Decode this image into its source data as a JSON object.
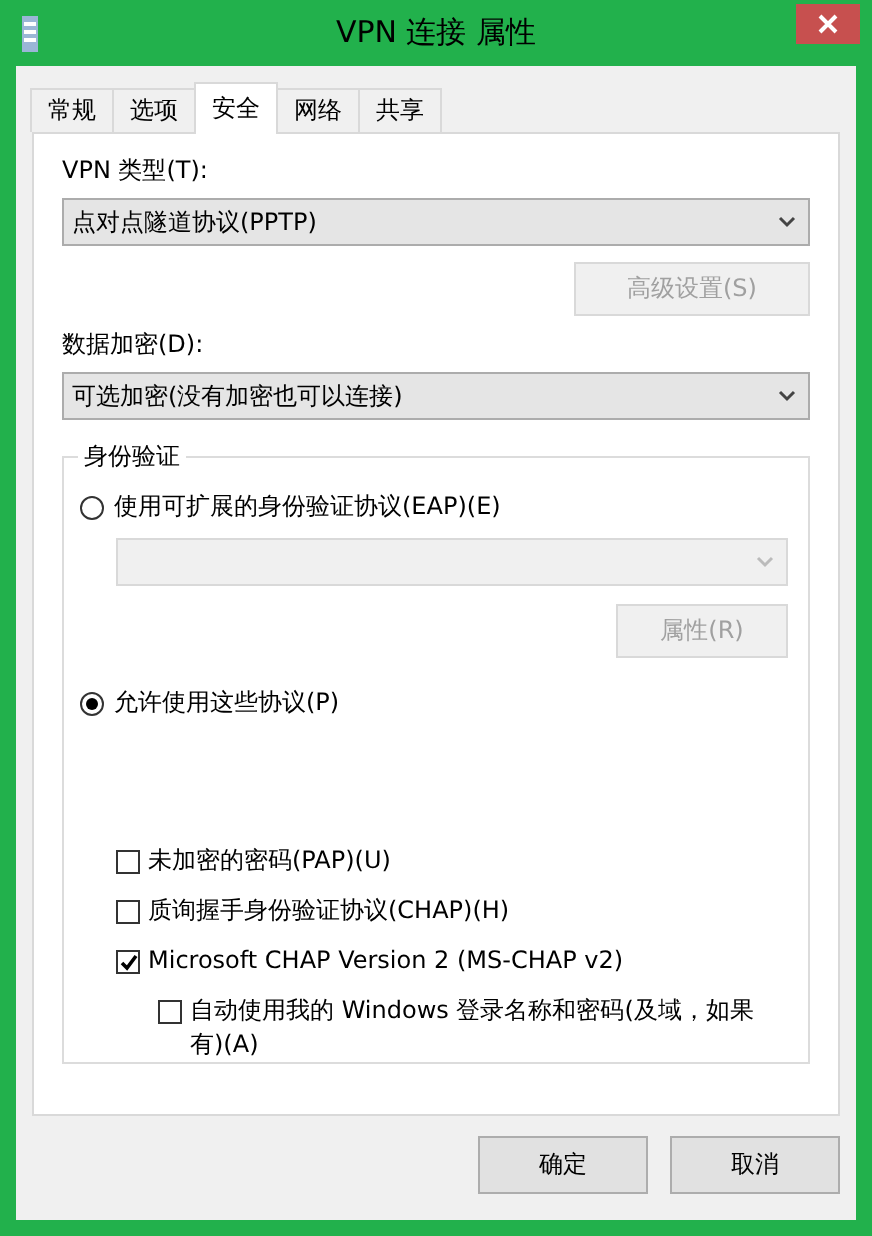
{
  "window": {
    "title": "VPN 连接 属性"
  },
  "tabs": [
    {
      "label": "常规",
      "selected": false
    },
    {
      "label": "选项",
      "selected": false
    },
    {
      "label": "安全",
      "selected": true
    },
    {
      "label": "网络",
      "selected": false
    },
    {
      "label": "共享",
      "selected": false
    }
  ],
  "vpn_type": {
    "label": "VPN 类型(T):",
    "value": "点对点隧道协议(PPTP)"
  },
  "advanced_button": {
    "label": "高级设置(S)",
    "disabled": true
  },
  "encryption": {
    "label": "数据加密(D):",
    "value": "可选加密(没有加密也可以连接)"
  },
  "authentication": {
    "title": "身份验证",
    "eap_radio": {
      "label": "使用可扩展的身份验证协议(EAP)(E)",
      "selected": false
    },
    "eap_dropdown": {
      "disabled": true
    },
    "properties_button": {
      "label": "属性(R)",
      "disabled": true
    },
    "protocols_radio": {
      "label": "允许使用这些协议(P)",
      "selected": true
    },
    "protocols": [
      {
        "label": "未加密的密码(PAP)(U)",
        "checked": false
      },
      {
        "label": "质询握手身份验证协议(CHAP)(H)",
        "checked": false
      },
      {
        "label": "Microsoft CHAP Version 2 (MS-CHAP v2)",
        "checked": true,
        "children": [
          {
            "label": "自动使用我的 Windows 登录名称和密码(及域，如果有)(A)",
            "checked": false
          }
        ]
      }
    ]
  },
  "buttons": [
    {
      "label": "确定"
    },
    {
      "label": "取消"
    }
  ]
}
